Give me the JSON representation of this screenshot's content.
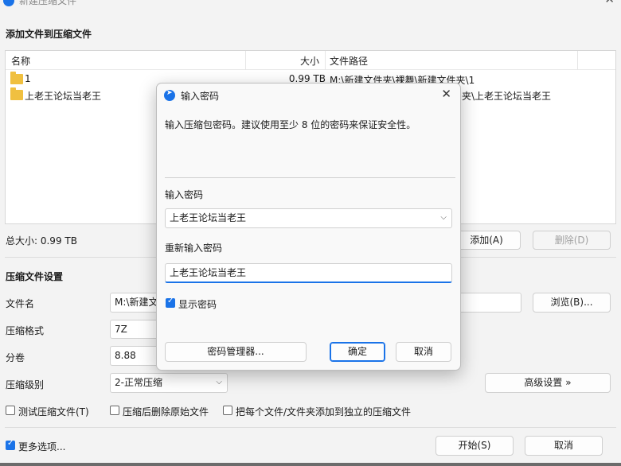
{
  "window": {
    "title": "新建压缩文件",
    "close_glyph": "✕"
  },
  "add_section": {
    "title": "添加文件到压缩文件"
  },
  "file_list": {
    "columns": {
      "name": "名称",
      "size": "大小",
      "path": "文件路径"
    },
    "rows": [
      {
        "name": "1",
        "size": "0.99 TB",
        "path": "M:\\新建文件夹\\裸舞\\新建文件夹\\1"
      },
      {
        "name": "上老王论坛当老王",
        "size": "",
        "path": "夹\\上老王论坛当老王"
      }
    ]
  },
  "total_size": "总大小: 0.99 TB",
  "buttons": {
    "add": "添加(A)",
    "delete": "删除(D)",
    "browse": "浏览(B)...",
    "advanced": "高级设置 »",
    "start": "开始(S)",
    "cancel": "取消"
  },
  "settings": {
    "title": "压缩文件设置",
    "filename_label": "文件名",
    "filename_value": "M:\\新建文",
    "format_label": "压缩格式",
    "format_value": "7Z",
    "volume_label": "分卷",
    "volume_value": "8.88",
    "level_label": "压缩级别",
    "level_value": "2-正常压缩"
  },
  "options": {
    "test": "测试压缩文件(T)",
    "delete_after": "压缩后删除原始文件",
    "each_separate": "把每个文件/文件夹添加到独立的压缩文件",
    "more_options": "更多选项..."
  },
  "dialog": {
    "title": "输入密码",
    "close_glyph": "✕",
    "message": "输入压缩包密码。建议使用至少 8 位的密码来保证安全性。",
    "password_label": "输入密码",
    "password_value": "上老王论坛当老王",
    "confirm_label": "重新输入密码",
    "confirm_value": "上老王论坛当老王",
    "show_password": "显示密码",
    "manager_button": "密码管理器...",
    "ok_button": "确定",
    "cancel_button": "取消"
  },
  "colors": {
    "accent": "#1a73e8",
    "folder": "#f0c040"
  }
}
